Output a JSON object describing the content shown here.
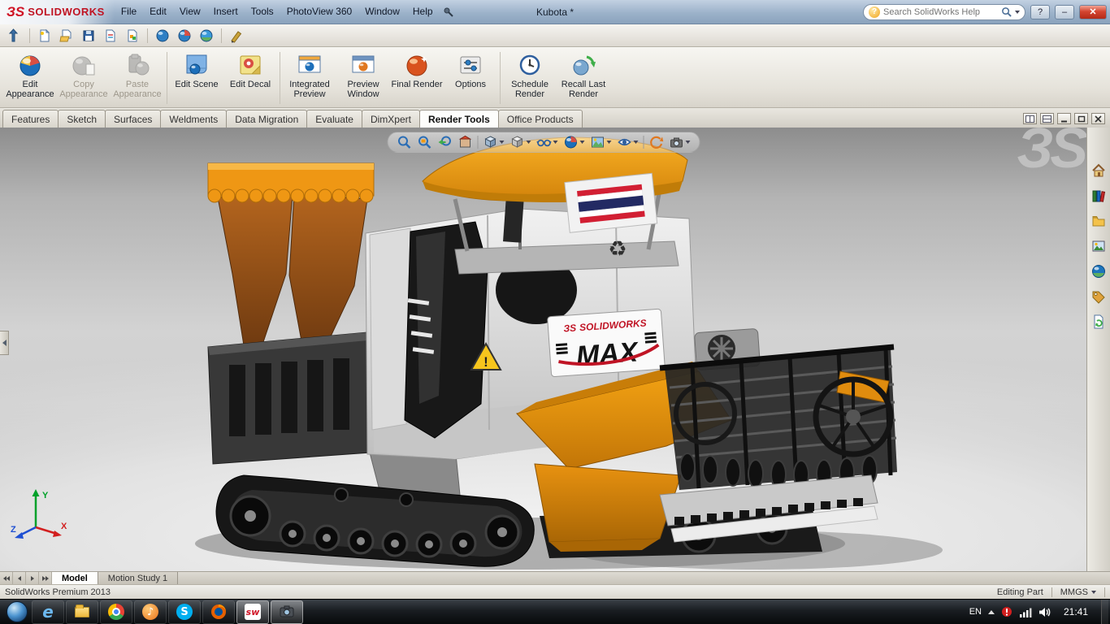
{
  "colors": {
    "accent_orange": "#f09a12",
    "brand_red": "#d01325",
    "titlebar_blue": "#9cb2ca",
    "viewport_gray": "#c8c8c8",
    "taskbar_black": "#14171a"
  },
  "titlebar": {
    "brand_mark": "ЗS",
    "brand": "SOLIDWORKS",
    "title": "Kubota *",
    "search_placeholder": "Search SolidWorks Help",
    "help_bubble_glyph": "?",
    "help_glyph": "?",
    "minimize_glyph": "–",
    "close_glyph": "✕",
    "menus": [
      "File",
      "Edit",
      "View",
      "Insert",
      "Tools",
      "PhotoView 360",
      "Window",
      "Help"
    ]
  },
  "ribbon": {
    "buttons": [
      {
        "label": "Edit Appearance"
      },
      {
        "label": "Copy Appearance"
      },
      {
        "label": "Paste Appearance"
      },
      {
        "label": "Edit Scene"
      },
      {
        "label": "Edit Decal"
      },
      {
        "label": "Integrated Preview"
      },
      {
        "label": "Preview Window"
      },
      {
        "label": "Final Render"
      },
      {
        "label": "Options"
      },
      {
        "label": "Schedule Render"
      },
      {
        "label": "Recall Last Render"
      }
    ]
  },
  "command_tabs": {
    "tabs": [
      "Features",
      "Sketch",
      "Surfaces",
      "Weldments",
      "Data Migration",
      "Evaluate",
      "DimXpert",
      "Render Tools",
      "Office Products"
    ],
    "active": "Render Tools"
  },
  "viewport": {
    "watermark": "ЗS",
    "axis": {
      "x": "X",
      "y": "Y",
      "z": "Z"
    },
    "model": {
      "decal_brand_mark": "ЗS",
      "decal_brand": "SOLIDWORKS",
      "decal_text": "MAX",
      "recycle_glyph": "♻",
      "warning_glyph": "!"
    }
  },
  "bottom_tabs": {
    "model": "Model",
    "motion": "Motion Study 1"
  },
  "statusbar": {
    "left": "SolidWorks Premium 2013",
    "editing": "Editing Part",
    "units": "MMGS"
  },
  "taskbar": {
    "tray_lang": "EN",
    "clock": "21:41",
    "ie_glyph": "e",
    "skype_glyph": "S",
    "solidworks_glyph": "sw",
    "media_glyph": "♪"
  }
}
